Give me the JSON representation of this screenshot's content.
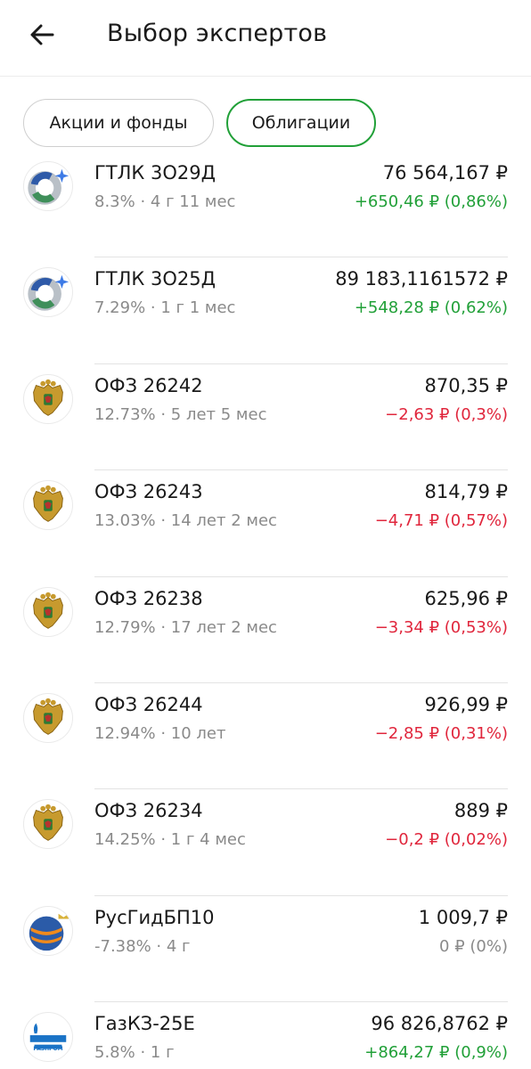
{
  "header": {
    "title": "Выбор экспертов",
    "back_icon": "arrow-left-icon"
  },
  "tabs": [
    {
      "label": "Акции и фонды",
      "active": false
    },
    {
      "label": "Облигации",
      "active": true
    }
  ],
  "colors": {
    "accent": "#21a038",
    "positive": "#21a038",
    "negative": "#e0263c",
    "neutral": "#8a8a8a"
  },
  "bonds": [
    {
      "name": "ГТЛК 3О29Д",
      "meta": "8.3% · 4 г 11 мес",
      "price": "76 564,167 ₽",
      "change": "+650,46 ₽ (0,86%)",
      "trend": "up",
      "icon": "gtlk-logo-icon"
    },
    {
      "name": "ГТЛК 3О25Д",
      "meta": "7.29% · 1 г 1 мес",
      "price": "89 183,1161572 ₽",
      "change": "+548,28 ₽ (0,62%)",
      "trend": "up",
      "icon": "gtlk-logo-icon"
    },
    {
      "name": "ОФЗ 26242",
      "meta": "12.73% · 5 лет 5 мес",
      "price": "870,35 ₽",
      "change": "−2,63 ₽ (0,3%)",
      "trend": "down",
      "icon": "russia-coat-of-arms-icon"
    },
    {
      "name": "ОФЗ 26243",
      "meta": "13.03% · 14 лет 2 мес",
      "price": "814,79 ₽",
      "change": "−4,71 ₽ (0,57%)",
      "trend": "down",
      "icon": "russia-coat-of-arms-icon"
    },
    {
      "name": "ОФЗ 26238",
      "meta": "12.79% · 17 лет 2 мес",
      "price": "625,96 ₽",
      "change": "−3,34 ₽ (0,53%)",
      "trend": "down",
      "icon": "russia-coat-of-arms-icon"
    },
    {
      "name": "ОФЗ 26244",
      "meta": "12.94% · 10 лет",
      "price": "926,99 ₽",
      "change": "−2,85 ₽ (0,31%)",
      "trend": "down",
      "icon": "russia-coat-of-arms-icon"
    },
    {
      "name": "ОФЗ 26234",
      "meta": "14.25% · 1 г 4 мес",
      "price": "889 ₽",
      "change": "−0,2 ₽ (0,02%)",
      "trend": "down",
      "icon": "russia-coat-of-arms-icon"
    },
    {
      "name": "РусГидБП10",
      "meta": "-7.38% · 4 г",
      "price": "1 009,7 ₽",
      "change": "0 ₽ (0%)",
      "trend": "flat",
      "icon": "rushydro-logo-icon"
    },
    {
      "name": "ГазКЗ-25Е",
      "meta": "5.8% · 1 г",
      "price": "96 826,8762 ₽",
      "change": "+864,27 ₽ (0,9%)",
      "trend": "up",
      "icon": "gazprom-logo-icon",
      "logo_text": "ГАЗПРОМ"
    }
  ]
}
